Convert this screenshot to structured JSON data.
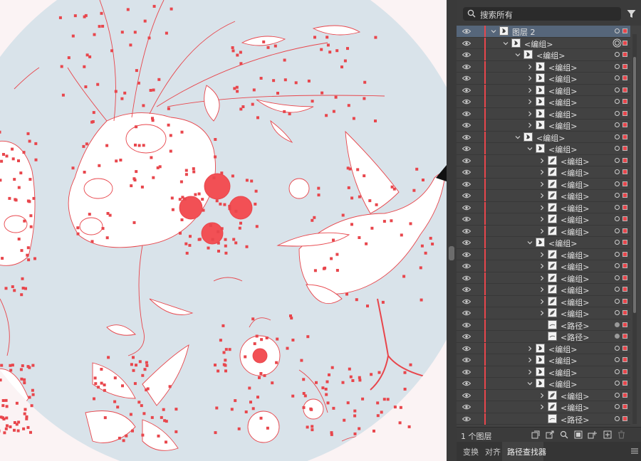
{
  "search": {
    "placeholder": "搜索所有"
  },
  "layers": [
    {
      "name": "图层 2",
      "depth": 0,
      "twist": "down",
      "selected": true,
      "target": "ring",
      "thumb": "layer"
    },
    {
      "name": "<编组>",
      "depth": 1,
      "twist": "down",
      "target": "double",
      "thumb": "group"
    },
    {
      "name": "<编组>",
      "depth": 2,
      "twist": "down",
      "target": "ring",
      "thumb": "group"
    },
    {
      "name": "<编组>",
      "depth": 3,
      "twist": "right",
      "target": "ring",
      "thumb": "group"
    },
    {
      "name": "<编组>",
      "depth": 3,
      "twist": "right",
      "target": "ring",
      "thumb": "group"
    },
    {
      "name": "<编组>",
      "depth": 3,
      "twist": "right",
      "target": "ring",
      "thumb": "group"
    },
    {
      "name": "<编组>",
      "depth": 3,
      "twist": "right",
      "target": "ring",
      "thumb": "group"
    },
    {
      "name": "<编组>",
      "depth": 3,
      "twist": "right",
      "target": "ring",
      "thumb": "group"
    },
    {
      "name": "<编组>",
      "depth": 3,
      "twist": "right",
      "target": "ring",
      "thumb": "group"
    },
    {
      "name": "<编组>",
      "depth": 2,
      "twist": "down",
      "target": "ring",
      "thumb": "group"
    },
    {
      "name": "<编组>",
      "depth": 3,
      "twist": "down",
      "target": "ring",
      "thumb": "group"
    },
    {
      "name": "<编组>",
      "depth": 4,
      "twist": "right",
      "target": "ring",
      "thumb": "leaf"
    },
    {
      "name": "<编组>",
      "depth": 4,
      "twist": "right",
      "target": "ring",
      "thumb": "leaf"
    },
    {
      "name": "<编组>",
      "depth": 4,
      "twist": "right",
      "target": "ring",
      "thumb": "leaf"
    },
    {
      "name": "<编组>",
      "depth": 4,
      "twist": "right",
      "target": "ring",
      "thumb": "leaf"
    },
    {
      "name": "<编组>",
      "depth": 4,
      "twist": "right",
      "target": "ring",
      "thumb": "leaf"
    },
    {
      "name": "<编组>",
      "depth": 4,
      "twist": "right",
      "target": "ring",
      "thumb": "leaf"
    },
    {
      "name": "<编组>",
      "depth": 4,
      "twist": "right",
      "target": "ring",
      "thumb": "leaf"
    },
    {
      "name": "<编组>",
      "depth": 3,
      "twist": "down",
      "target": "ring",
      "thumb": "group"
    },
    {
      "name": "<编组>",
      "depth": 4,
      "twist": "right",
      "target": "ring",
      "thumb": "leaf"
    },
    {
      "name": "<编组>",
      "depth": 4,
      "twist": "right",
      "target": "ring",
      "thumb": "leaf"
    },
    {
      "name": "<编组>",
      "depth": 4,
      "twist": "right",
      "target": "ring",
      "thumb": "leaf"
    },
    {
      "name": "<编组>",
      "depth": 4,
      "twist": "right",
      "target": "ring",
      "thumb": "leaf"
    },
    {
      "name": "<编组>",
      "depth": 4,
      "twist": "right",
      "target": "ring",
      "thumb": "leaf"
    },
    {
      "name": "<编组>",
      "depth": 4,
      "twist": "right",
      "target": "ring",
      "thumb": "leaf"
    },
    {
      "name": "<路径>",
      "depth": 4,
      "twist": "none",
      "target": "filled",
      "thumb": "path"
    },
    {
      "name": "<路径>",
      "depth": 4,
      "twist": "none",
      "target": "filled",
      "thumb": "path"
    },
    {
      "name": "<编组>",
      "depth": 3,
      "twist": "right",
      "target": "ring",
      "thumb": "group"
    },
    {
      "name": "<编组>",
      "depth": 3,
      "twist": "right",
      "target": "ring",
      "thumb": "group"
    },
    {
      "name": "<编组>",
      "depth": 3,
      "twist": "right",
      "target": "ring",
      "thumb": "group"
    },
    {
      "name": "<编组>",
      "depth": 3,
      "twist": "down",
      "target": "ring",
      "thumb": "group"
    },
    {
      "name": "<编组>",
      "depth": 4,
      "twist": "right",
      "target": "ring",
      "thumb": "leaf"
    },
    {
      "name": "<编组>",
      "depth": 4,
      "twist": "right",
      "target": "ring",
      "thumb": "leaf"
    },
    {
      "name": "<路径>",
      "depth": 4,
      "twist": "none",
      "target": "ring",
      "thumb": "path"
    }
  ],
  "status": {
    "layer_count": "1 个图层"
  },
  "bottom_tabs": [
    {
      "label": "变换"
    },
    {
      "label": "对齐"
    },
    {
      "label": "路径查找器",
      "active": true
    }
  ],
  "colors": {
    "selection": "#e8464c",
    "canvas_bg": "#d9e3ea",
    "selected_row": "#56667a"
  }
}
